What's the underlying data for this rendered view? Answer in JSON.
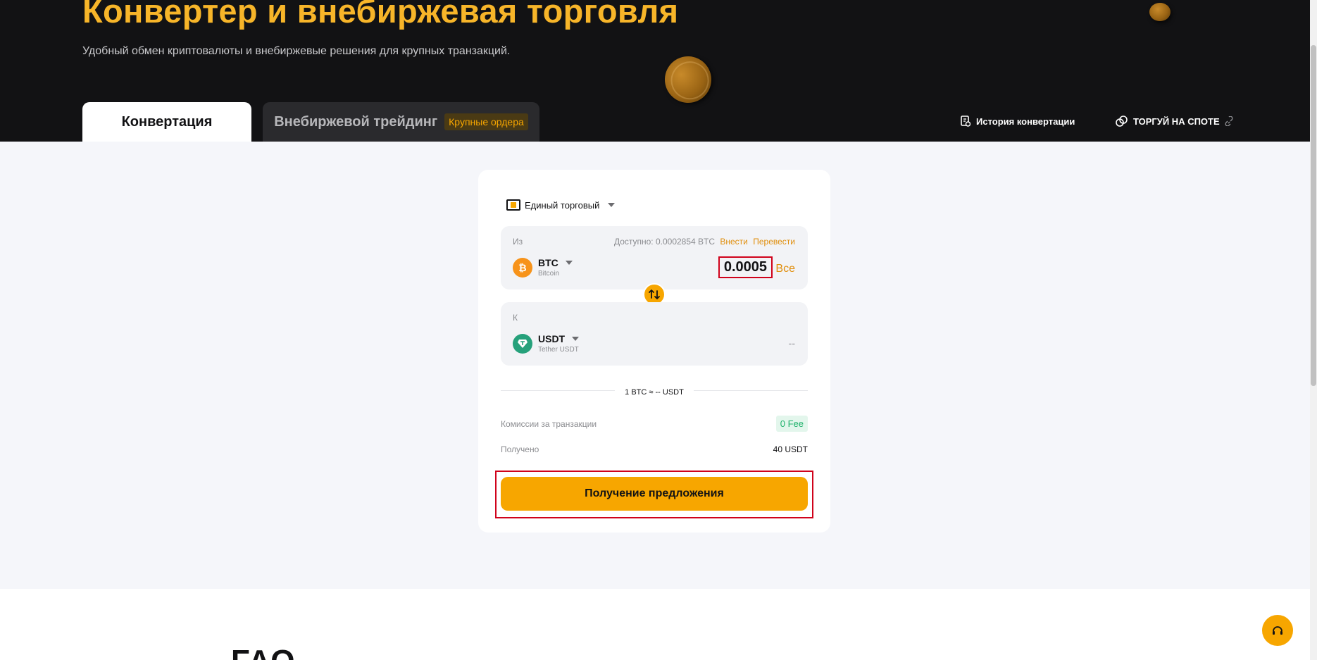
{
  "hero": {
    "title": "Конвертер и внебиржевая торговля",
    "subtitle": "Удобный обмен криптовалюты и внебиржевые решения для крупных транзакций."
  },
  "tabs": [
    {
      "label": "Конвертация",
      "active": true
    },
    {
      "label": "Внебиржевой трейдинг",
      "badge": "Крупные ордера",
      "active": false
    }
  ],
  "links": {
    "history": "История конвертации",
    "spot": "ТОРГУЙ НА СПОТЕ"
  },
  "card": {
    "account": "Единый торговый",
    "from": {
      "label": "Из",
      "available": "Доступно: 0.0002854 BTC",
      "deposit": "Внести",
      "transfer": "Перевести",
      "symbol": "BTC",
      "name": "Bitcoin",
      "amount": "0.0005",
      "all": "Все"
    },
    "to": {
      "label": "К",
      "symbol": "USDT",
      "name": "Tether USDT",
      "amount": "--"
    },
    "rate": "1 BTC ≈ -- USDT",
    "fee_label": "Комиссии за транзакции",
    "fee_value": "0 Fee",
    "received_label": "Получено",
    "received_value": "40 USDT",
    "button": "Получение предложения"
  },
  "faq": "FAQ",
  "colors": {
    "accent": "#f7a600",
    "title": "#f7b529",
    "highlight": "#d0021b",
    "fee_green": "#20b26c"
  }
}
